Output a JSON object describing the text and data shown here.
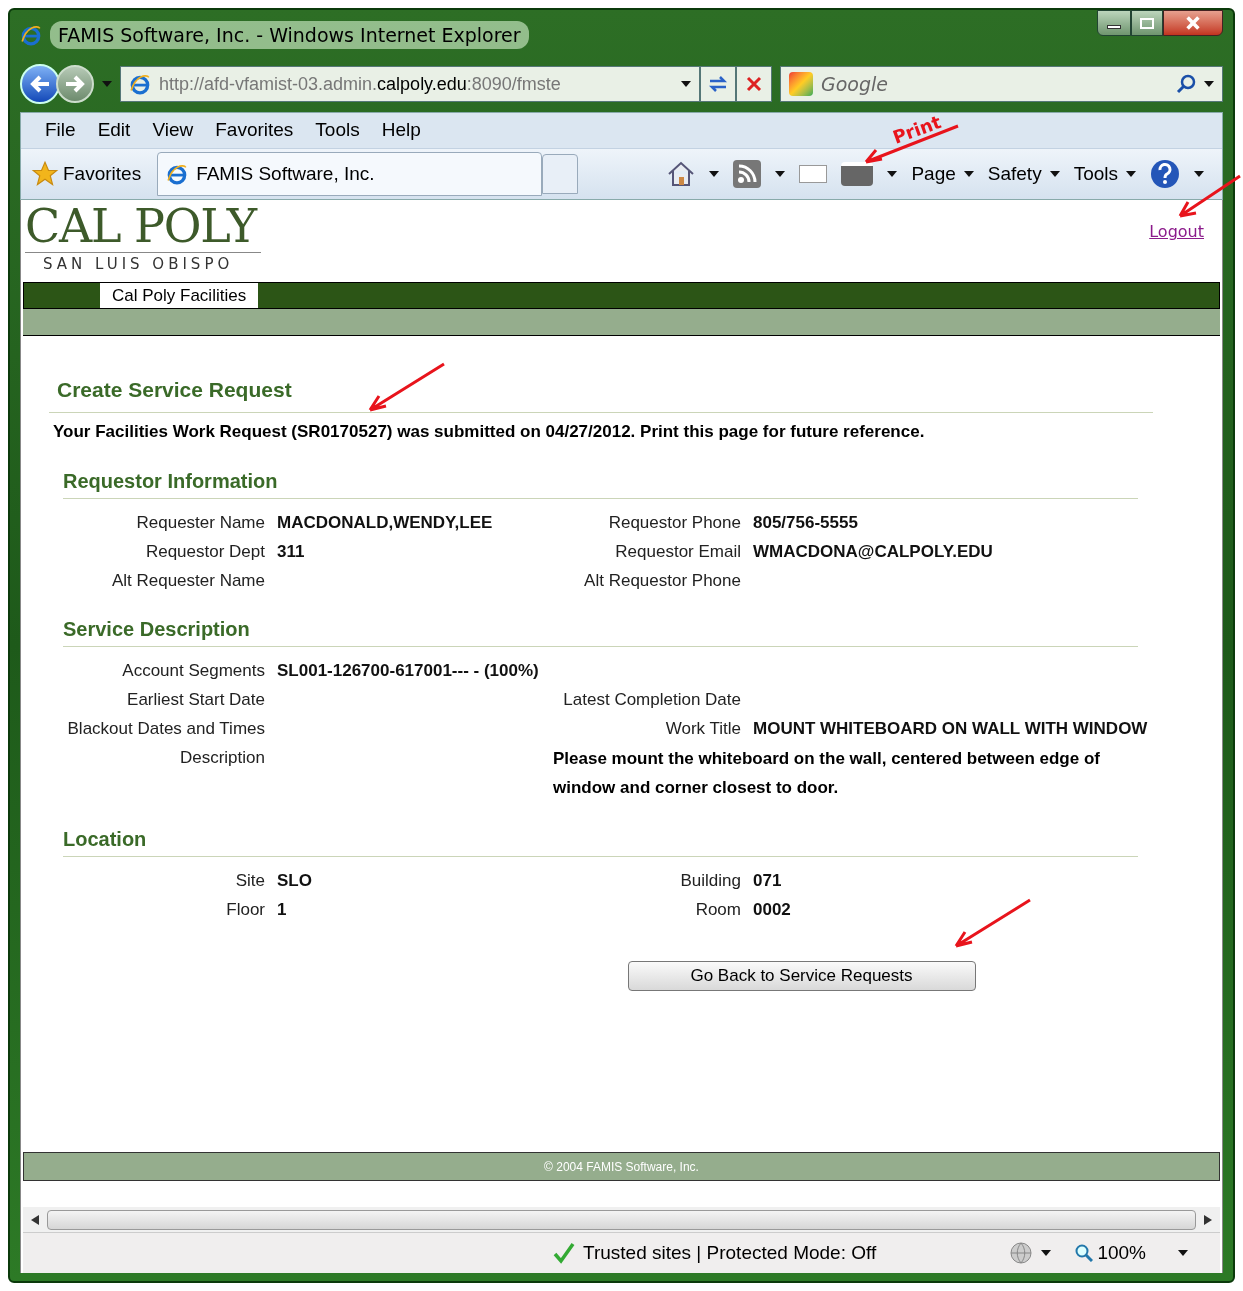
{
  "window": {
    "title": "FAMIS Software, Inc. - Windows Internet Explorer"
  },
  "address": {
    "url": [
      {
        "text": "http://afd-vfamist-03.admin.",
        "emphasis": false
      },
      {
        "text": "calpoly.edu",
        "emphasis": true
      },
      {
        "text": ":8090/fmste",
        "emphasis": false
      }
    ]
  },
  "search": {
    "placeholder": "Google"
  },
  "menu": [
    "File",
    "Edit",
    "View",
    "Favorites",
    "Tools",
    "Help"
  ],
  "favorites": {
    "label": "Favorites"
  },
  "tab": {
    "title": "FAMIS Software, Inc."
  },
  "command_bar": [
    "Page",
    "Safety",
    "Tools"
  ],
  "annotation": {
    "label": "Print"
  },
  "page": {
    "logo": {
      "title": "CAL POLY",
      "subtitle": "SAN LUIS OBISPO"
    },
    "logout": "Logout",
    "nav_tab": "Cal Poly Facilities",
    "heading": "Create Service Request",
    "message": "Your Facilities Work Request (SR0170527) was submitted on 04/27/2012. Print this page for future reference.",
    "sections": [
      {
        "title": "Requestor Information",
        "rows": [
          {
            "kind": "pair",
            "left": {
              "label": "Requester Name",
              "value": "MACDONALD,WENDY,LEE"
            },
            "right": {
              "label": "Requestor Phone",
              "value": "805/756-5555"
            }
          },
          {
            "kind": "pair",
            "left": {
              "label": "Requestor Dept",
              "value": "311"
            },
            "right": {
              "label": "Requestor Email",
              "value": "WMACDONA@CALPOLY.EDU"
            }
          },
          {
            "kind": "pair",
            "left": {
              "label": "Alt Requester Name"
            },
            "right": {
              "label": "Alt Requestor Phone"
            }
          }
        ]
      },
      {
        "title": "Service Description",
        "rows": [
          {
            "kind": "pair",
            "left": {
              "label": "Account Segments",
              "value": "SL001-126700-617001--- - (100%)"
            }
          },
          {
            "kind": "pair",
            "left": {
              "label": "Earliest Start Date"
            },
            "right": {
              "label": "Latest Completion Date"
            }
          },
          {
            "kind": "pair",
            "left": {
              "label": "Blackout Dates and Times"
            },
            "right": {
              "label": "Work Title",
              "value": "MOUNT WHITEBOARD ON WALL WITH WINDOW"
            }
          },
          {
            "kind": "wide",
            "label": "Description",
            "value": "Please mount the whiteboard on the wall, centered between edge of window and corner closest to door."
          }
        ]
      },
      {
        "title": "Location",
        "rows": [
          {
            "kind": "pair",
            "left": {
              "label": "Site",
              "value": "SLO"
            },
            "right": {
              "label": "Building",
              "value": "071"
            }
          },
          {
            "kind": "pair",
            "left": {
              "label": "Floor",
              "value": "1"
            },
            "right": {
              "label": "Room",
              "value": "0002"
            }
          }
        ]
      }
    ],
    "button": "Go Back to Service Requests",
    "footer": "© 2004 FAMIS Software, Inc."
  },
  "status_bar": {
    "zone": "Trusted sites | Protected Mode: Off",
    "zoom": "100%"
  }
}
